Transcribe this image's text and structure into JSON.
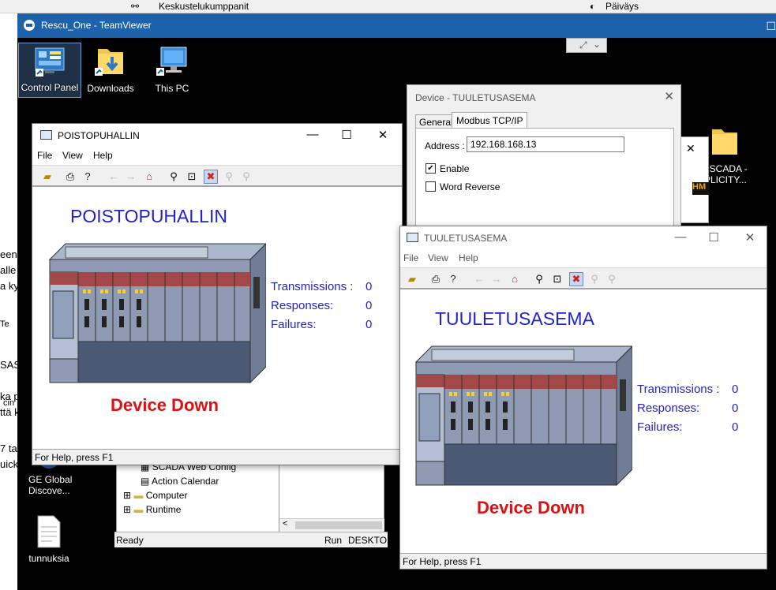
{
  "host": {
    "col1": "Keskustelukumppanit",
    "col2": "Päiväys",
    "left_fragments": [
      "een",
      "alle",
      "a ky",
      "Te",
      "SAS",
      "ka p",
      "ttä k",
      "cin",
      "7 ta",
      "uick"
    ]
  },
  "teamviewer": {
    "title": "Rescu_One - TeamViewer",
    "logo_icon": "teamviewer-logo-icon",
    "toolbar_icon": "fullscreen-icon"
  },
  "desktop": {
    "icons": [
      {
        "label": "Control Panel",
        "icon": "control-panel-icon"
      },
      {
        "label": "Downloads",
        "icon": "folder-download-icon"
      },
      {
        "label": "This PC",
        "icon": "computer-icon"
      },
      {
        "label": "GE Global Discove...",
        "icon": "ge-app-icon"
      },
      {
        "label": "tunnuksia",
        "icon": "text-file-icon"
      },
      {
        "label": "MI SCADA - MPLICITY...",
        "icon": "folder-icon"
      }
    ]
  },
  "device_dialog": {
    "title": "Device - TUULETUSASEMA",
    "tabs": [
      "General",
      "Modbus TCP/IP"
    ],
    "address_label": "Address :",
    "address_value": "192.168.168.13",
    "enable_label": "Enable",
    "enable_checked": true,
    "word_reverse_label": "Word Reverse",
    "word_reverse_checked": false
  },
  "project_tree": {
    "items": [
      "SCADA Web Config",
      "Action Calendar",
      "Computer",
      "Runtime"
    ],
    "status_ready": "Ready",
    "status_run": "Run",
    "status_host": "DESKTOP-V"
  },
  "win1": {
    "title": "POISTOPUHALLIN",
    "menu": [
      "File",
      "View",
      "Help"
    ],
    "device_name": "POISTOPUHALLIN",
    "labels": {
      "transmissions": "Transmissions :",
      "responses": "Responses:",
      "failures": "Failures:"
    },
    "values": {
      "transmissions": "0",
      "responses": "0",
      "failures": "0"
    },
    "state": "Device Down",
    "status": "For Help, press F1"
  },
  "win2": {
    "title": "TUULETUSASEMA",
    "menu": [
      "File",
      "View",
      "Help"
    ],
    "device_name": "TUULETUSASEMA",
    "labels": {
      "transmissions": "Transmissions :",
      "responses": "Responses:",
      "failures": "Failures:"
    },
    "values": {
      "transmissions": "0",
      "responses": "0",
      "failures": "0"
    },
    "state": "Device Down",
    "status": "For Help, press F1"
  },
  "colors": {
    "teamviewer_blue": "#1d62aa",
    "device_text": "#2222cc",
    "device_down": "#dd1111"
  }
}
